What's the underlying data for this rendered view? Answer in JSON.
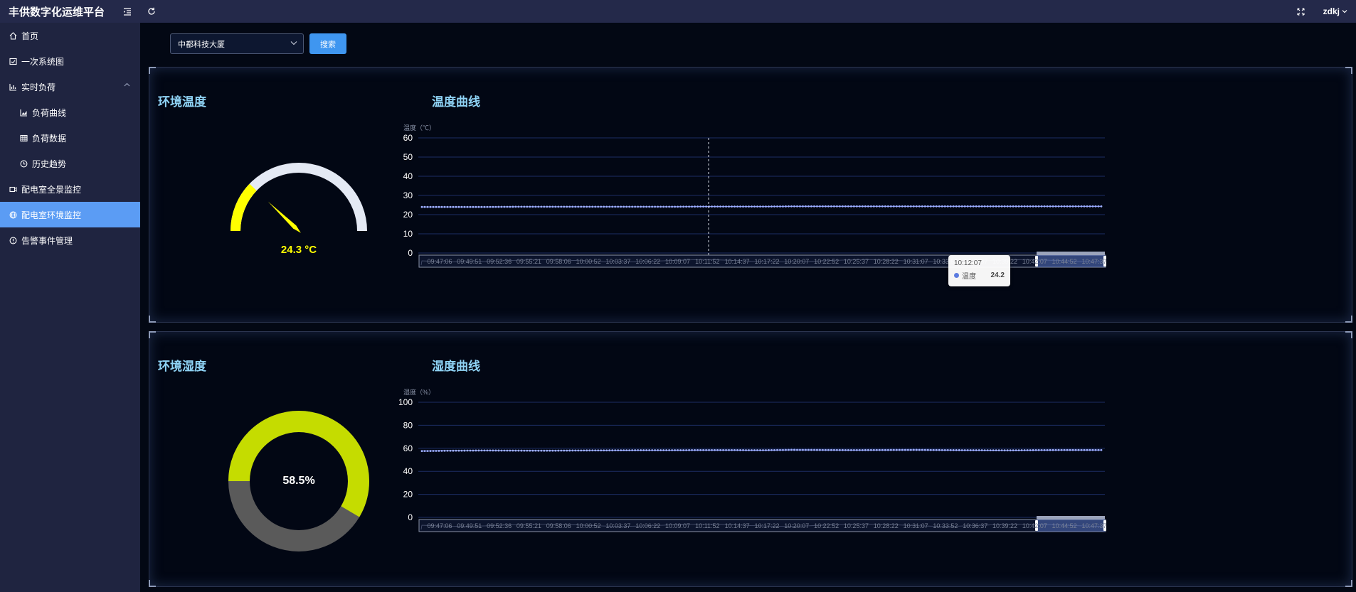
{
  "app": {
    "title": "丰供数字化运维平台"
  },
  "header": {
    "user": "zdkj"
  },
  "sidebar": {
    "items": [
      {
        "label": "首页",
        "icon": "home-icon"
      },
      {
        "label": "一次系统图",
        "icon": "diagram-icon"
      },
      {
        "label": "实时负荷",
        "icon": "bar-chart-icon",
        "expanded": true
      },
      {
        "label": "负荷曲线",
        "icon": "area-chart-icon"
      },
      {
        "label": "负荷数据",
        "icon": "table-icon"
      },
      {
        "label": "历史趋势",
        "icon": "clock-icon"
      },
      {
        "label": "配电室全景监控",
        "icon": "camera-icon"
      },
      {
        "label": "配电室环境监控",
        "icon": "globe-icon",
        "active": true
      },
      {
        "label": "告警事件管理",
        "icon": "alert-icon"
      }
    ]
  },
  "filter": {
    "building": "中都科技大厦",
    "search_label": "搜索"
  },
  "temperature": {
    "title": "环境温度",
    "curve_title": "温度曲线",
    "value": 24.3,
    "display": "24.3 °C",
    "max": 100
  },
  "humidity": {
    "title": "环境湿度",
    "curve_title": "湿度曲线",
    "value": 58.5,
    "display": "58.5%"
  },
  "tooltip": {
    "time": "10:12:07",
    "series": "温度",
    "value": "24.2"
  },
  "colors": {
    "gauge_fill": "#ffff00",
    "gauge_track": "#e4e9f4",
    "donut_fill": "#c5dc00",
    "donut_track": "#5a5a5a",
    "series_line": "#7d8ff0",
    "grid": "#1c2d63",
    "accent": "#3f96f0"
  },
  "chart_data": [
    {
      "type": "line",
      "ylabel": "温度（℃）",
      "ylim": [
        0,
        60
      ],
      "yticks": [
        0,
        10,
        20,
        30,
        40,
        50,
        60
      ],
      "xticks": [
        "09:47:06",
        "09:49:51",
        "09:52:36",
        "09:55:21",
        "09:58:06",
        "10:00:52",
        "10:03:37",
        "10:06:22",
        "10:09:07",
        "10:11:52",
        "10:14:37",
        "10:17:22",
        "10:20:07",
        "10:22:52",
        "10:25:37",
        "10:28:22",
        "10:31:07",
        "10:33:52",
        "10:36:37",
        "10:39:22",
        "10:42:07",
        "10:44:52",
        "10:47:37"
      ],
      "series": [
        {
          "name": "温度",
          "values": [
            24.0,
            24.0,
            24.0,
            24.1,
            24.1,
            24.1,
            24.1,
            24.1,
            24.1,
            24.2,
            24.2,
            24.2,
            24.3,
            24.3,
            24.3,
            24.3,
            24.3,
            24.3,
            24.3,
            24.3,
            24.3,
            24.3,
            24.3
          ]
        }
      ]
    },
    {
      "type": "line",
      "ylabel": "湿度（%）",
      "ylim": [
        0,
        100
      ],
      "yticks": [
        0,
        20,
        40,
        60,
        80,
        100
      ],
      "xticks": [
        "09:47:06",
        "09:49:51",
        "09:52:36",
        "09:55:21",
        "09:58:06",
        "10:00:52",
        "10:03:37",
        "10:06:22",
        "10:09:07",
        "10:11:52",
        "10:14:37",
        "10:17:22",
        "10:20:07",
        "10:22:52",
        "10:25:37",
        "10:28:22",
        "10:31:07",
        "10:33:52",
        "10:36:37",
        "10:39:22",
        "10:42:07",
        "10:44:52",
        "10:47:37"
      ],
      "series": [
        {
          "name": "湿度",
          "values": [
            57.6,
            57.9,
            58.1,
            58.0,
            57.9,
            58.1,
            58.2,
            58.3,
            58.3,
            58.4,
            58.4,
            58.3,
            58.6,
            58.5,
            58.4,
            58.5,
            58.6,
            58.4,
            58.3,
            58.2,
            58.4,
            58.5,
            58.5
          ]
        }
      ]
    }
  ]
}
